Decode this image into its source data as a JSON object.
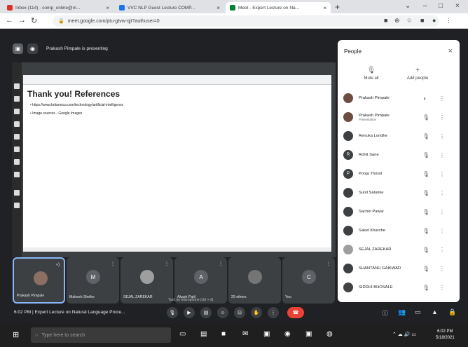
{
  "browser": {
    "tabs": [
      {
        "label": "Inbox (114) - comp_online@m...",
        "active": false
      },
      {
        "label": "VVC NLP Guest Lecture COMP...",
        "active": false
      },
      {
        "label": "Meet - Expert Lecture on Na...",
        "active": true
      }
    ],
    "new_tab": "+",
    "url": "meet.google.com/ptu-gtvw-qjt?authuser=0"
  },
  "meet": {
    "presenting_text": "Prakash Pimpale is presenting",
    "meeting_info": "6:02 PM | Expert Lecture on Natural Language Proce...",
    "mic_hint": "Turn on microphone (ctrl + d)"
  },
  "shared_screen": {
    "title": "Thank you! References",
    "bullets": [
      "https://www.britannica.com/technology/artificial-intelligence",
      "Image sources - Google Images"
    ]
  },
  "people_panel": {
    "title": "People",
    "actions": [
      {
        "label": "Mute all",
        "icon": "mute-all-icon"
      },
      {
        "label": "Add people",
        "icon": "add-person-icon"
      }
    ],
    "participants": [
      {
        "name": "Prakash Pimpale",
        "sub": ""
      },
      {
        "name": "Prakash Pimpale",
        "sub": "Presentation"
      },
      {
        "name": "Renuka Londhe",
        "sub": ""
      },
      {
        "name": "Rohit Sane",
        "sub": ""
      },
      {
        "name": "Pooja Thorat",
        "sub": ""
      },
      {
        "name": "Sunil Salunke",
        "sub": ""
      },
      {
        "name": "Sachin Pawar",
        "sub": ""
      },
      {
        "name": "Saket Kharche",
        "sub": ""
      },
      {
        "name": "SEJAL ZAREKAR",
        "sub": ""
      },
      {
        "name": "SHANTANU GAIKWAD",
        "sub": ""
      },
      {
        "name": "SIDDHI BHOSALE",
        "sub": ""
      }
    ]
  },
  "filmstrip": [
    {
      "name": "Prakash Pimpale",
      "initial": "",
      "self": true
    },
    {
      "name": "Mahesh Shelke",
      "initial": "M",
      "self": false
    },
    {
      "name": "SEJAL ZAREKAR",
      "initial": "",
      "self": false
    },
    {
      "name": "Akash Patil",
      "initial": "A",
      "self": false
    },
    {
      "name": "29 others",
      "initial": "",
      "self": false
    },
    {
      "name": "You",
      "initial": "C",
      "self": false
    }
  ],
  "taskbar": {
    "search_placeholder": "Type here to search",
    "time": "6:02 PM",
    "date": "5/18/2021"
  },
  "colors": {
    "meet_bg": "#202124",
    "leave_red": "#ea4335",
    "accent_blue": "#8ab4f8"
  }
}
